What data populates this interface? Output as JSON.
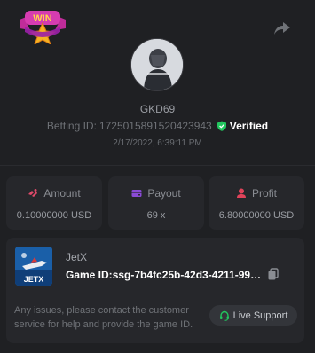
{
  "header": {
    "badge_text": "WIN"
  },
  "profile": {
    "username": "GKD69",
    "betting_id_label": "Betting ID:",
    "betting_id": "1725015891520423943",
    "verified_label": "Verified",
    "timestamp": "2/17/2022, 6:39:11 PM"
  },
  "stats": {
    "amount": {
      "label": "Amount",
      "value": "0.10000000 USD"
    },
    "payout": {
      "label": "Payout",
      "value": "69 x"
    },
    "profit": {
      "label": "Profit",
      "value": "6.80000000 USD"
    }
  },
  "game": {
    "name": "JetX",
    "thumb_text": "JETX",
    "game_id_label": "Game ID:",
    "game_id": "ssg-7b4fc25b-42d3-4211-99a...",
    "support_text": "Any issues, please contact the customer service for help and provide the game ID.",
    "live_support_label": "Live Support"
  },
  "colors": {
    "background": "#1f2023",
    "card": "#26272b",
    "amount_icon": "#e04a6a",
    "payout_icon": "#8a4bd6",
    "profit_icon": "#e0435a",
    "verified_icon": "#22c55e",
    "support_icon": "#22c55e"
  }
}
